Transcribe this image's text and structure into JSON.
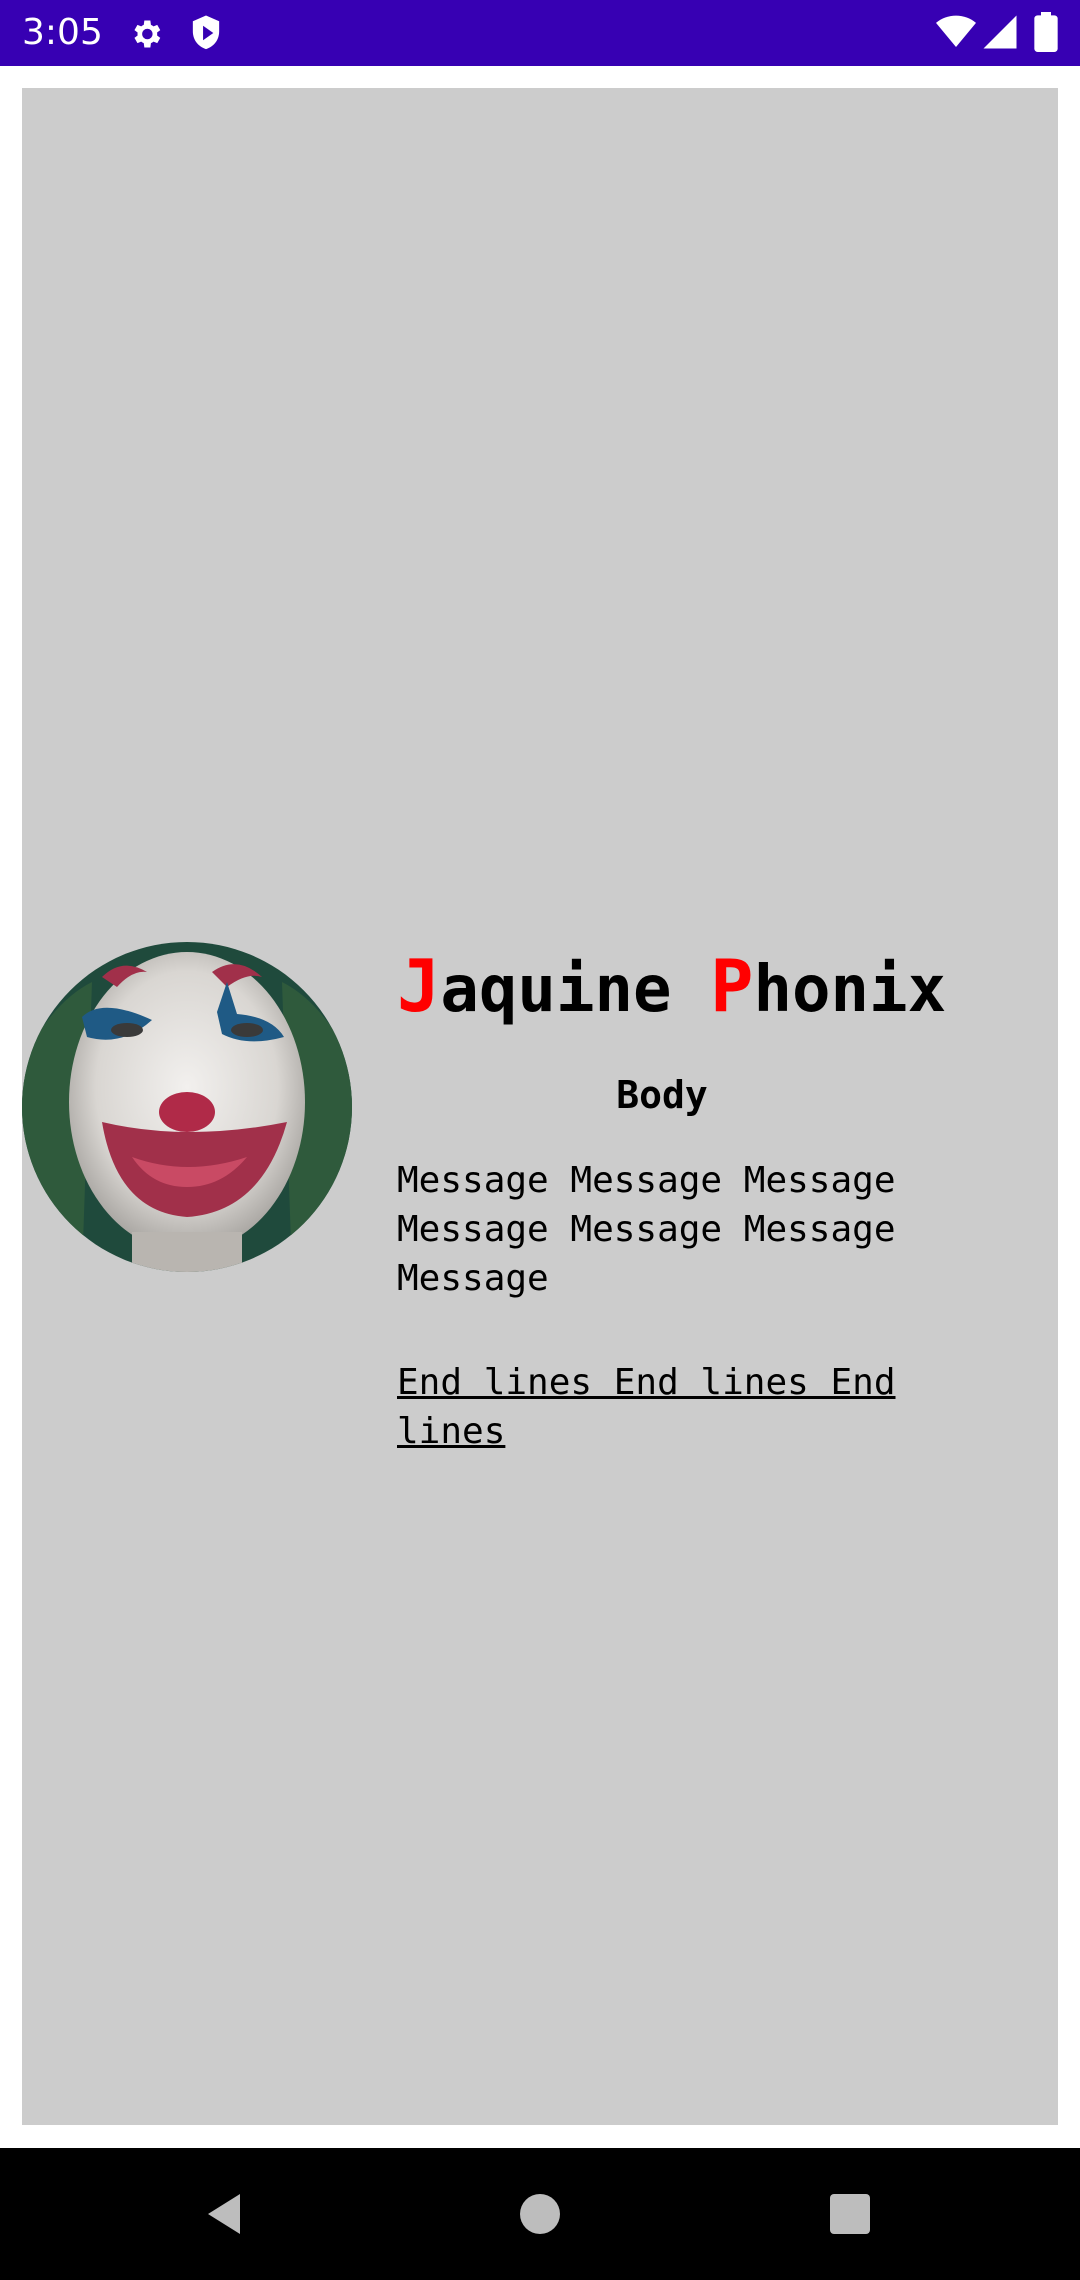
{
  "status_bar": {
    "time": "3:05",
    "icons": [
      "gear-icon",
      "shield-icon",
      "wifi-icon",
      "cellular-icon",
      "battery-icon"
    ],
    "background": "#3700b3"
  },
  "card": {
    "background": "#cccccc",
    "name": {
      "first_initial": "J",
      "first_rest": "aquine ",
      "last_initial": "P",
      "last_rest": "honix",
      "initial_color": "#ff0000"
    },
    "body_title": "Body",
    "message": "Message Message Message Message Message Message Message",
    "end_lines": "End lines End lines End lines"
  },
  "nav_bar": {
    "buttons": [
      "back-icon",
      "home-icon",
      "recents-icon"
    ]
  }
}
